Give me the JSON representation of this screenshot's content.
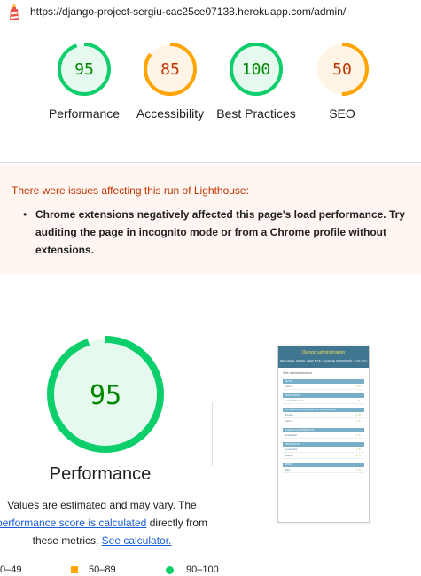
{
  "url": "https://django-project-sergiu-cac25ce07138.herokuapp.com/admin/",
  "colors": {
    "pass": "#0cce6b",
    "pass_text": "#008800",
    "pass_fill": "#e5f9ee",
    "average": "#ffa400",
    "average_text": "#c33300",
    "average_fill": "#fff4e5",
    "warning_bg": "#fff6f1"
  },
  "gauges": [
    {
      "score": "95",
      "label": "Performance",
      "rating": "pass"
    },
    {
      "score": "85",
      "label": "Accessibility",
      "rating": "average"
    },
    {
      "score": "100",
      "label": "Best Practices",
      "rating": "pass"
    },
    {
      "score": "50",
      "label": "SEO",
      "rating": "average"
    }
  ],
  "warning": {
    "title": "There were issues affecting this run of Lighthouse:",
    "item": "Chrome extensions negatively affected this page's load performance. Try auditing the page in incognito mode or from a Chrome profile without extensions."
  },
  "performance": {
    "score": "95",
    "title": "Performance",
    "desc_prefix": "Values are estimated and may vary. The ",
    "desc_link": "performance score is calculated",
    "desc_middle": " directly from these metrics. ",
    "desc_link2": "See calculator.",
    "rating": "pass"
  },
  "legend": [
    {
      "label": "0–49"
    },
    {
      "label": "50–89"
    },
    {
      "label": "90–100"
    }
  ],
  "thumbnail": {
    "header": "Django administration",
    "sub": "WELCOME, ADMIN. VIEW SITE / CHANGE PASSWORD / LOG OUT",
    "title": "Site administration",
    "modules": [
      {
        "name": "AUTH",
        "rows": [
          "Users"
        ]
      },
      {
        "name": "ACCOUNTS",
        "rows": [
          "Email addresses"
        ]
      },
      {
        "name": "AUTHENTICATION AND AUTHORIZATION",
        "rows": [
          "Groups",
          "Users"
        ]
      },
      {
        "name": "DJANGO Q PRODUCTS",
        "rows": [
          "Newsletter"
        ]
      },
      {
        "name": "PRODUCTS",
        "rows": [
          "Comments",
          "Brands"
        ]
      },
      {
        "name": "SITES",
        "rows": [
          "Sites"
        ]
      }
    ]
  }
}
